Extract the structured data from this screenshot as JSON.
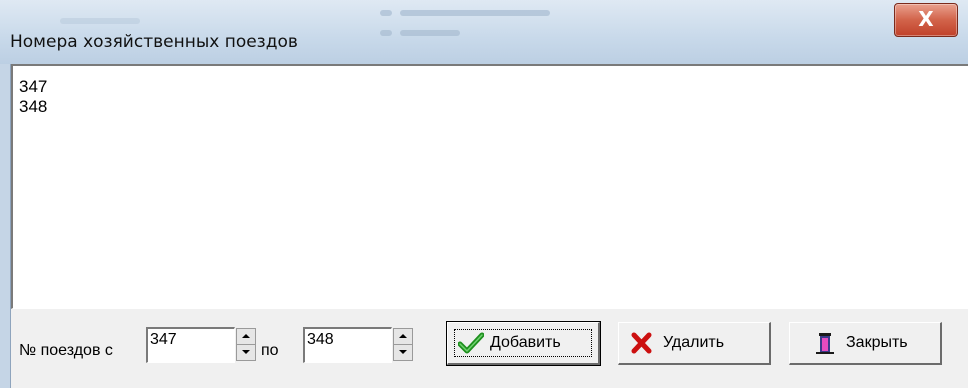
{
  "window": {
    "title": "Номера хозяйственных поездов",
    "close_label": "X"
  },
  "list": {
    "items": [
      "347",
      "348"
    ]
  },
  "footer": {
    "range_label": "№ поездов с",
    "from_value": "347",
    "to_label": "по",
    "to_value": "348",
    "add_label": "Добавить",
    "delete_label": "Удалить",
    "close_label": "Закрыть"
  },
  "icons": {
    "add": "checkmark-icon",
    "delete": "red-x-icon",
    "close": "door-exit-icon"
  },
  "colors": {
    "check_green": "#1e8f1e",
    "delete_red": "#cc1010",
    "close_button": "#c9472e"
  }
}
